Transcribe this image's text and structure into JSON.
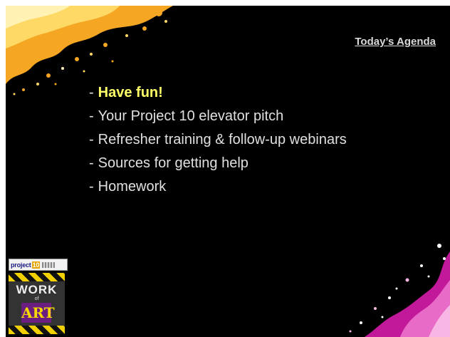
{
  "slide": {
    "title": "Today’s Agenda",
    "bullets": [
      {
        "dash": "-",
        "text": "Have fun!"
      },
      {
        "dash": "-",
        "text": "Your Project 10 elevator pitch"
      },
      {
        "dash": "-",
        "text": "Refresher training & follow-up webinars"
      },
      {
        "dash": "-",
        "text": "Sources for getting help"
      },
      {
        "dash": "-",
        "text": "Homework"
      }
    ]
  },
  "logo": {
    "project_prefix": "project",
    "project_number": "10",
    "work_word": "WORK",
    "of_word": "of",
    "art_word": "ART"
  },
  "colors": {
    "background": "#000000",
    "text": "#e0e0e0",
    "highlight": "#ffff66",
    "splash_orange": "#f5a623",
    "splash_magenta": "#c2189a"
  }
}
